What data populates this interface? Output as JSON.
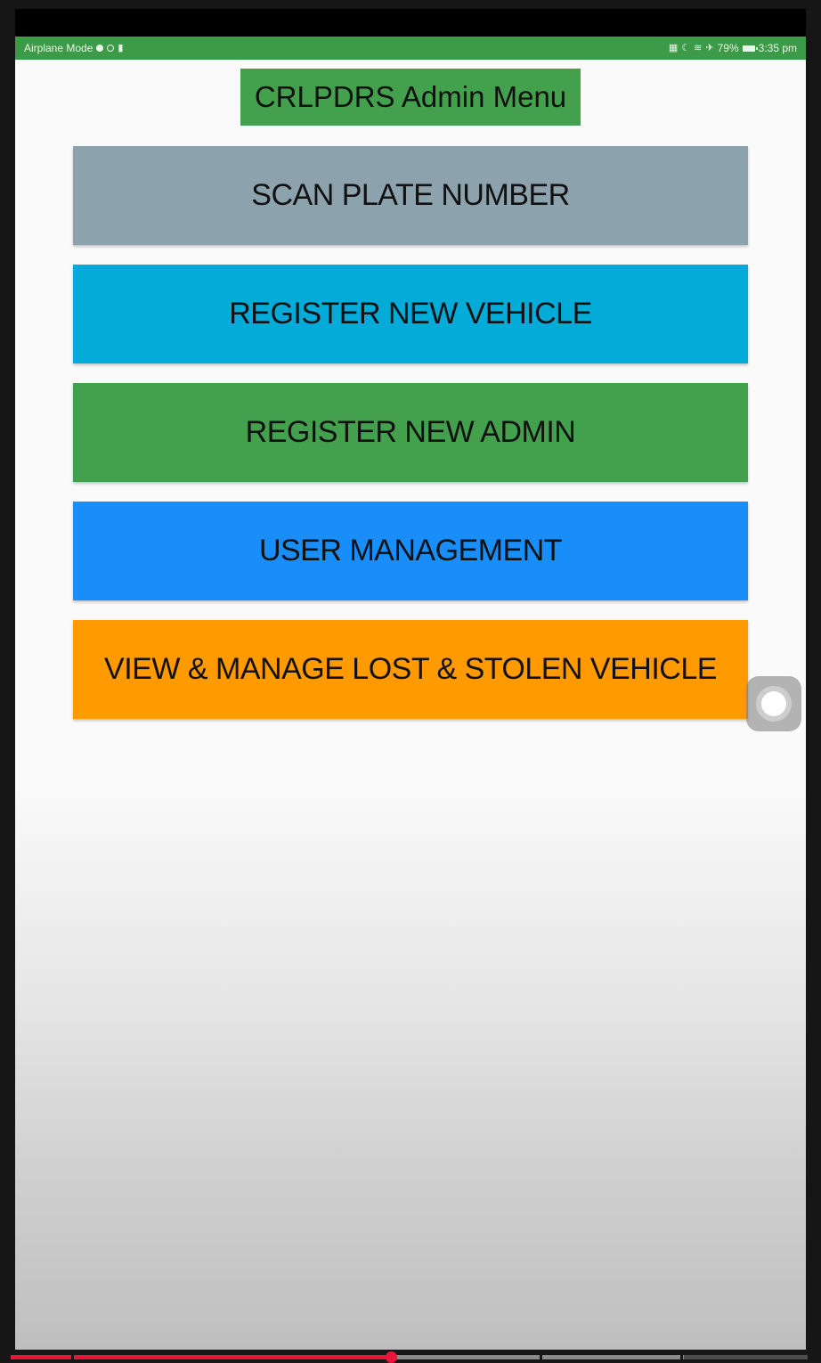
{
  "status_bar": {
    "left_text": "Airplane Mode",
    "battery_text": "79%",
    "time": "3:35 pm"
  },
  "title": "CRLPDRS Admin Menu",
  "menu": [
    {
      "label": "SCAN PLATE NUMBER",
      "color": "#8ca2ad"
    },
    {
      "label": "REGISTER NEW VEHICLE",
      "color": "#03abd8"
    },
    {
      "label": "REGISTER NEW ADMIN",
      "color": "#43a04d"
    },
    {
      "label": "USER MANAGEMENT",
      "color": "#1a8ef8"
    },
    {
      "label": "VIEW & MANAGE LOST & STOLEN VEHICLE",
      "color": "#ff9a00"
    }
  ],
  "colors": {
    "status_bar": "#3d9a47",
    "title_bar": "#43a04d",
    "progress_played": "#e8163a"
  },
  "video_progress": {
    "played_fraction": 0.477,
    "buffered_fraction": 0.845
  },
  "icons": {
    "assistive_touch": "assistive-touch-icon"
  }
}
